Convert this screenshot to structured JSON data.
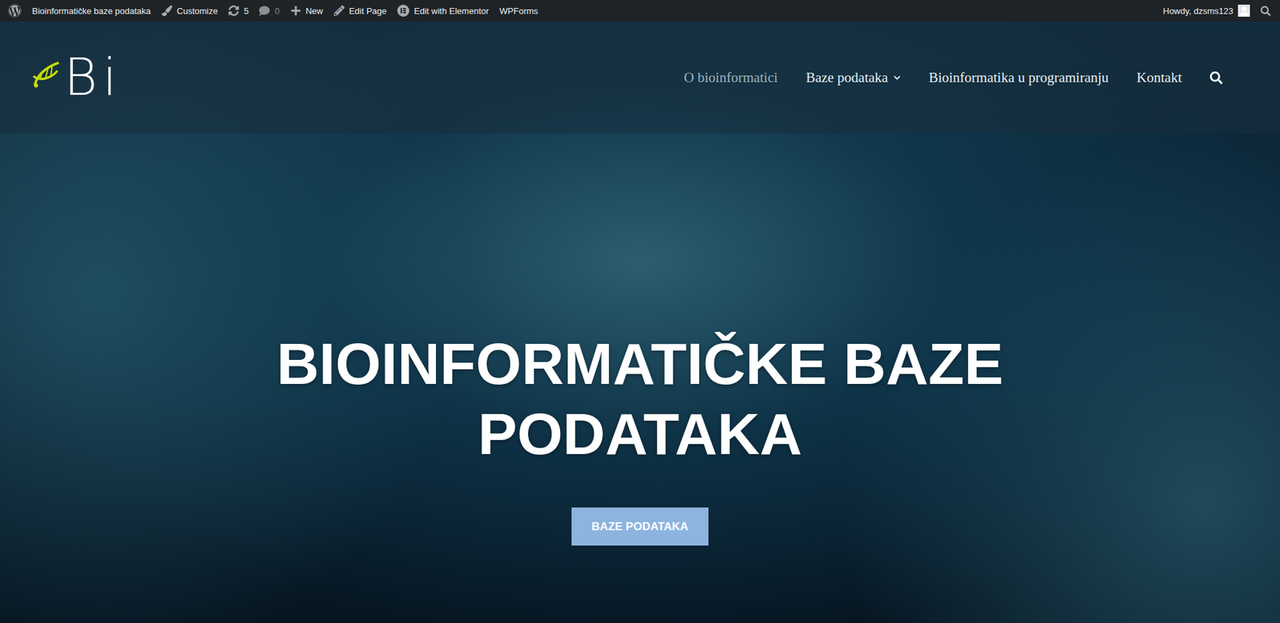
{
  "admin_bar": {
    "items": [
      {
        "label": "Bioinformatičke baze podataka",
        "kind": "site",
        "dimmed": false
      },
      {
        "label": "Customize",
        "kind": "customize",
        "dimmed": false
      },
      {
        "label": "5",
        "kind": "updates",
        "dimmed": false
      },
      {
        "label": "0",
        "kind": "comments",
        "dimmed": true
      },
      {
        "label": "New",
        "kind": "new",
        "dimmed": false
      },
      {
        "label": "Edit Page",
        "kind": "edit",
        "dimmed": false
      },
      {
        "label": "Edit with Elementor",
        "kind": "elementor",
        "dimmed": false
      },
      {
        "label": "WPForms",
        "kind": "plain",
        "dimmed": false
      }
    ],
    "greeting": "Howdy, dzsms123"
  },
  "header": {
    "logo": "Bi",
    "nav": [
      {
        "label": "O bioinformatici",
        "selected": true,
        "has_submenu": false
      },
      {
        "label": "Baze podataka",
        "selected": false,
        "has_submenu": true
      },
      {
        "label": "Bioinformatika u programiranju",
        "selected": false,
        "has_submenu": false
      },
      {
        "label": "Kontakt",
        "selected": false,
        "has_submenu": false
      }
    ]
  },
  "hero": {
    "title": "BIOINFORMATIČKE BAZE PODATAKA",
    "button": "BAZE PODATAKA"
  }
}
